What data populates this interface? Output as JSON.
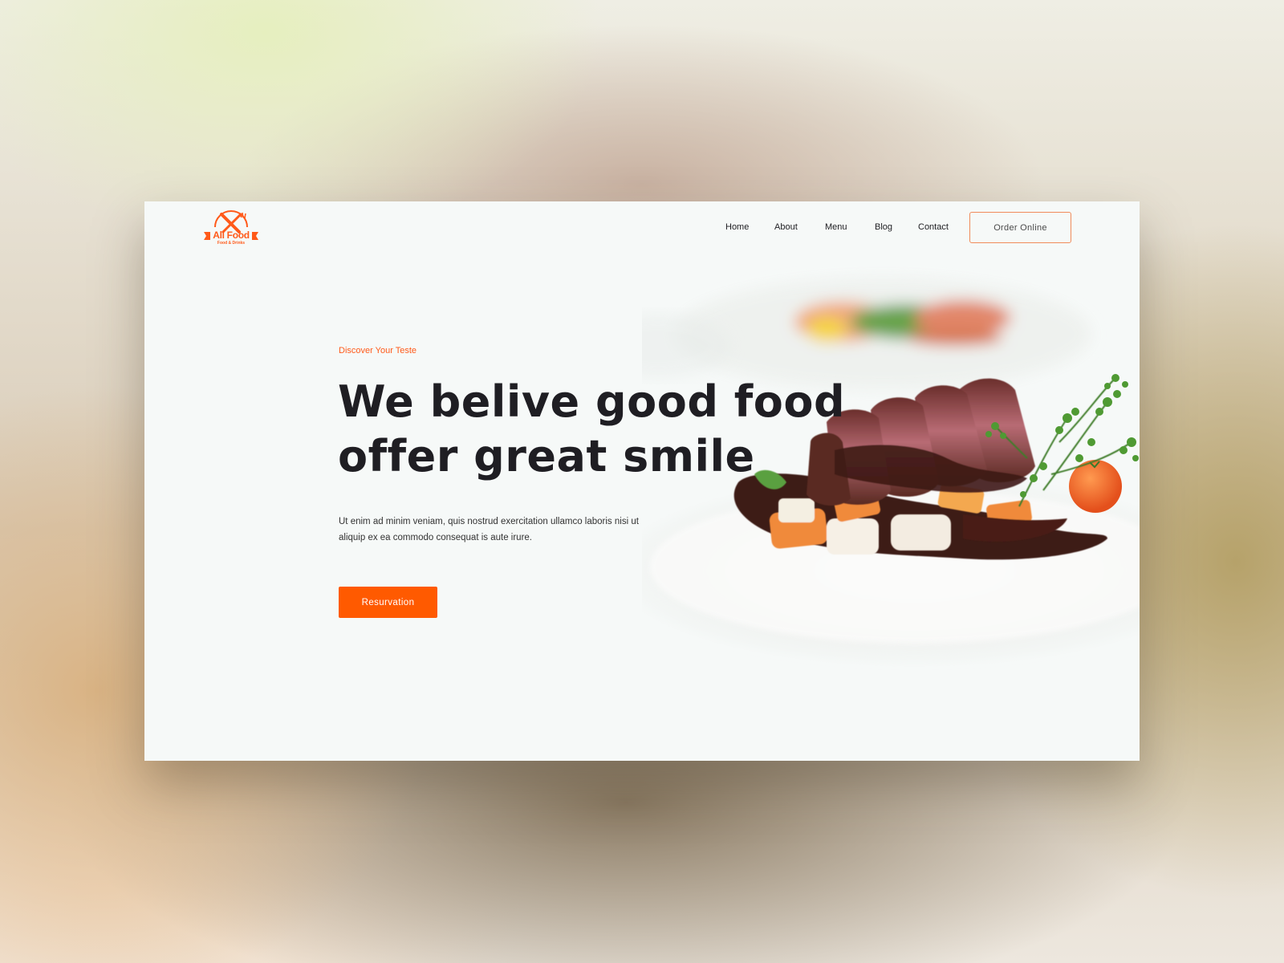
{
  "colors": {
    "accent": "#ff5a00",
    "heading": "#1f1e23",
    "panel_background": "#f6f9f8",
    "order_button_border": "#f08b5a"
  },
  "brand": {
    "logo_icon": "crossed-fork-knife-icon",
    "name": "All Food",
    "tagline": "Food & Drinks"
  },
  "nav": {
    "items": [
      {
        "label": "Home"
      },
      {
        "label": "About"
      },
      {
        "label": "Menu"
      },
      {
        "label": "Blog"
      },
      {
        "label": "Contact"
      }
    ],
    "order_button": "Order Online"
  },
  "hero": {
    "eyebrow": "Discover Your Teste",
    "headline_line1": "We belive good food",
    "headline_line2": "offer great smile",
    "description_line1": "Ut enim ad minim veniam, quis nostrud exercitation ullamco laboris nisi ut",
    "description_line2": "aliquip ex ea commodo consequat is aute irure.",
    "cta": "Resurvation",
    "image": "plated-steak-with-vegetables"
  }
}
